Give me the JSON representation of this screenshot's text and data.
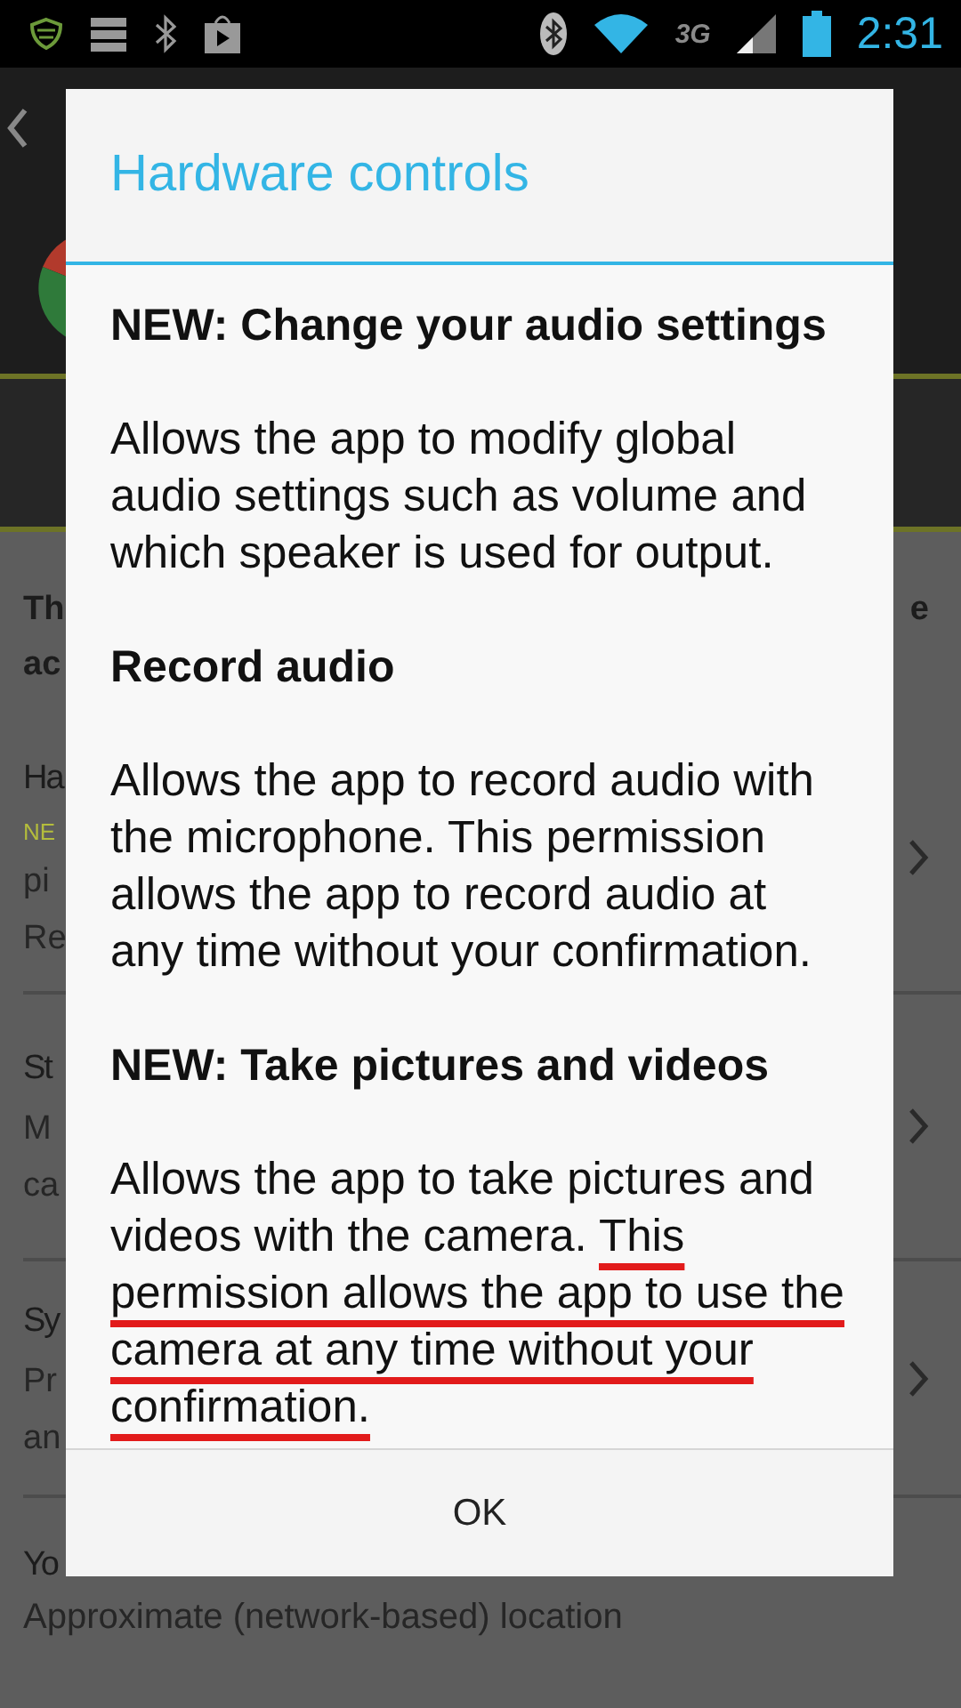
{
  "status_bar": {
    "network": "3G",
    "time": "2:31"
  },
  "background": {
    "intro": {
      "line_1": "Th",
      "line_2": "ac",
      "line_end": "e"
    },
    "groups": [
      {
        "title": "Ha",
        "chevron": true,
        "lines": [
          {
            "text": "NE",
            "kind": "tag"
          },
          {
            "text": "pi",
            "kind": "plain"
          },
          {
            "text": "Re",
            "kind": "plain"
          }
        ]
      },
      {
        "title": "St",
        "chevron": true,
        "lines": [
          {
            "text": "M",
            "kind": "plain"
          },
          {
            "text": "ca",
            "kind": "plain"
          }
        ]
      },
      {
        "title": "Sy",
        "chevron": true,
        "lines": [
          {
            "text": "Pr",
            "kind": "plain"
          },
          {
            "text": "an",
            "kind": "plain"
          }
        ]
      },
      {
        "title": "Yo",
        "chevron": false,
        "lines": [
          {
            "text": "Approximate (network-based) location",
            "kind": "plain"
          }
        ]
      }
    ]
  },
  "dialog": {
    "title": "Hardware controls",
    "sections": [
      {
        "heading": "NEW: Change your audio settings",
        "text": "Allows the app to modify global audio settings such as volume and which speaker is used for output."
      },
      {
        "heading": "Record audio",
        "text": "Allows the app to record audio with the microphone. This permission allows the app to record audio at any time without your confirmation."
      },
      {
        "heading": "NEW: Take pictures and videos",
        "text": "Allows the app to take pictures and videos with the camera. ",
        "marked_text": "This permission allows the app to use the camera at any time without your confirmation."
      }
    ],
    "button": "OK"
  }
}
